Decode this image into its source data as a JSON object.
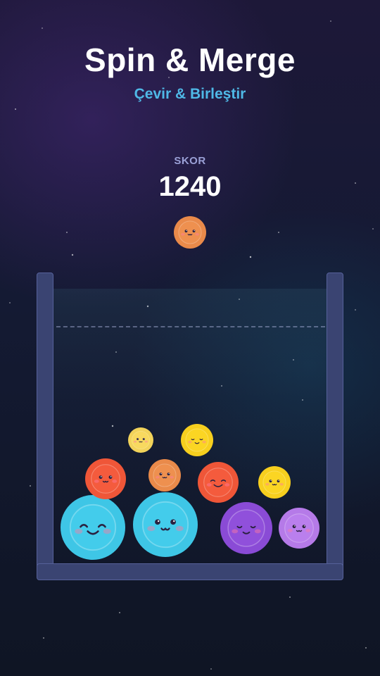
{
  "header": {
    "title": "Spin & Merge",
    "subtitle": "Çevir & Birleştir"
  },
  "score": {
    "label": "SKOR",
    "value": "1240"
  },
  "colors": {
    "cyan": "#3ec6e6",
    "purple": "#8a4bd6",
    "lilac": "#b57ae8",
    "red": "#ef5638",
    "orange": "#e98a4a",
    "yellow": "#f7cf1e",
    "pale_yellow": "#f2d35a",
    "wall": "#3a4472"
  },
  "next_ball": {
    "color": "orange",
    "face": "smile"
  },
  "balls": [
    {
      "color": "cyan",
      "face": "happy"
    },
    {
      "color": "cyan",
      "face": "open"
    },
    {
      "color": "purple",
      "face": "sleepy"
    },
    {
      "color": "lilac",
      "face": "open"
    },
    {
      "color": "red",
      "face": "smile"
    },
    {
      "color": "orange",
      "face": "smile"
    },
    {
      "color": "red",
      "face": "grin"
    },
    {
      "color": "yellow",
      "face": "smile"
    },
    {
      "color": "pale_yellow",
      "face": "smile"
    },
    {
      "color": "yellow",
      "face": "sleepy"
    }
  ]
}
